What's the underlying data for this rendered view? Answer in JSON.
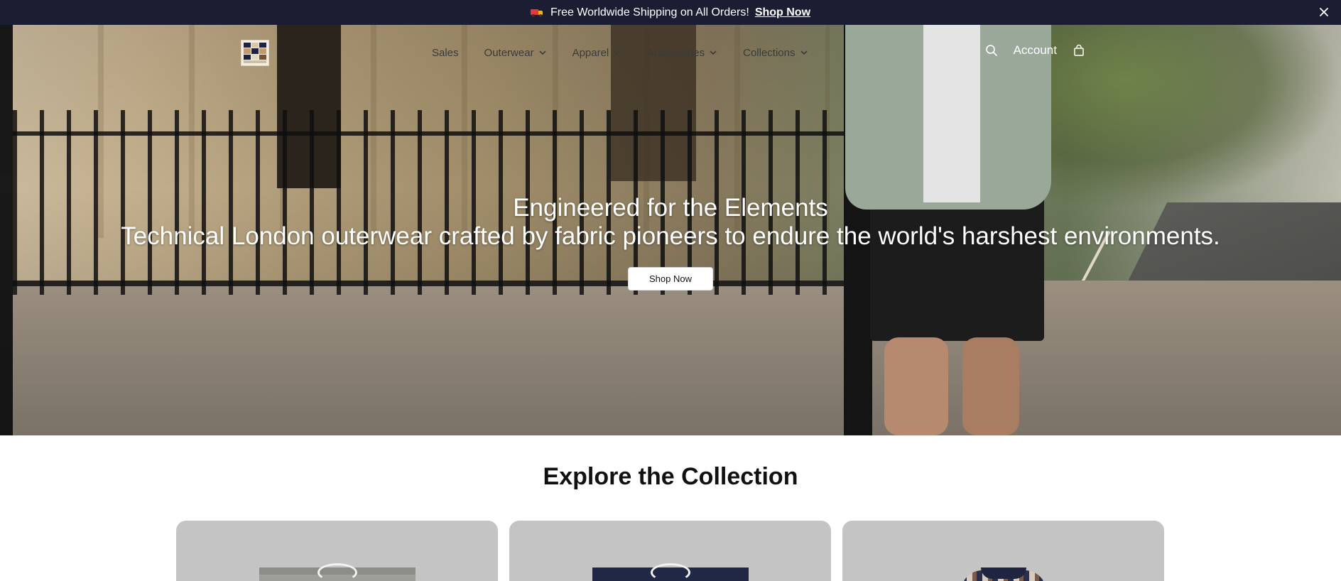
{
  "announcement": {
    "text": "Free Worldwide Shipping on All Orders!",
    "link": "Shop Now"
  },
  "header": {
    "nav": [
      {
        "label": "Sales",
        "dropdown": false
      },
      {
        "label": "Outerwear",
        "dropdown": true
      },
      {
        "label": "Apparel",
        "dropdown": true
      },
      {
        "label": "Accessories",
        "dropdown": true
      },
      {
        "label": "Collections",
        "dropdown": true
      }
    ],
    "account": "Account"
  },
  "hero": {
    "title": "Engineered for the Elements",
    "subtitle": "Technical London outerwear crafted by fabric pioneers to endure the world's harshest environments.",
    "button": "Shop Now"
  },
  "collection": {
    "title": "Explore the Collection"
  },
  "colors": {
    "announcement_bg": "#1b1d33",
    "card_bg": "#c4c4c4"
  }
}
